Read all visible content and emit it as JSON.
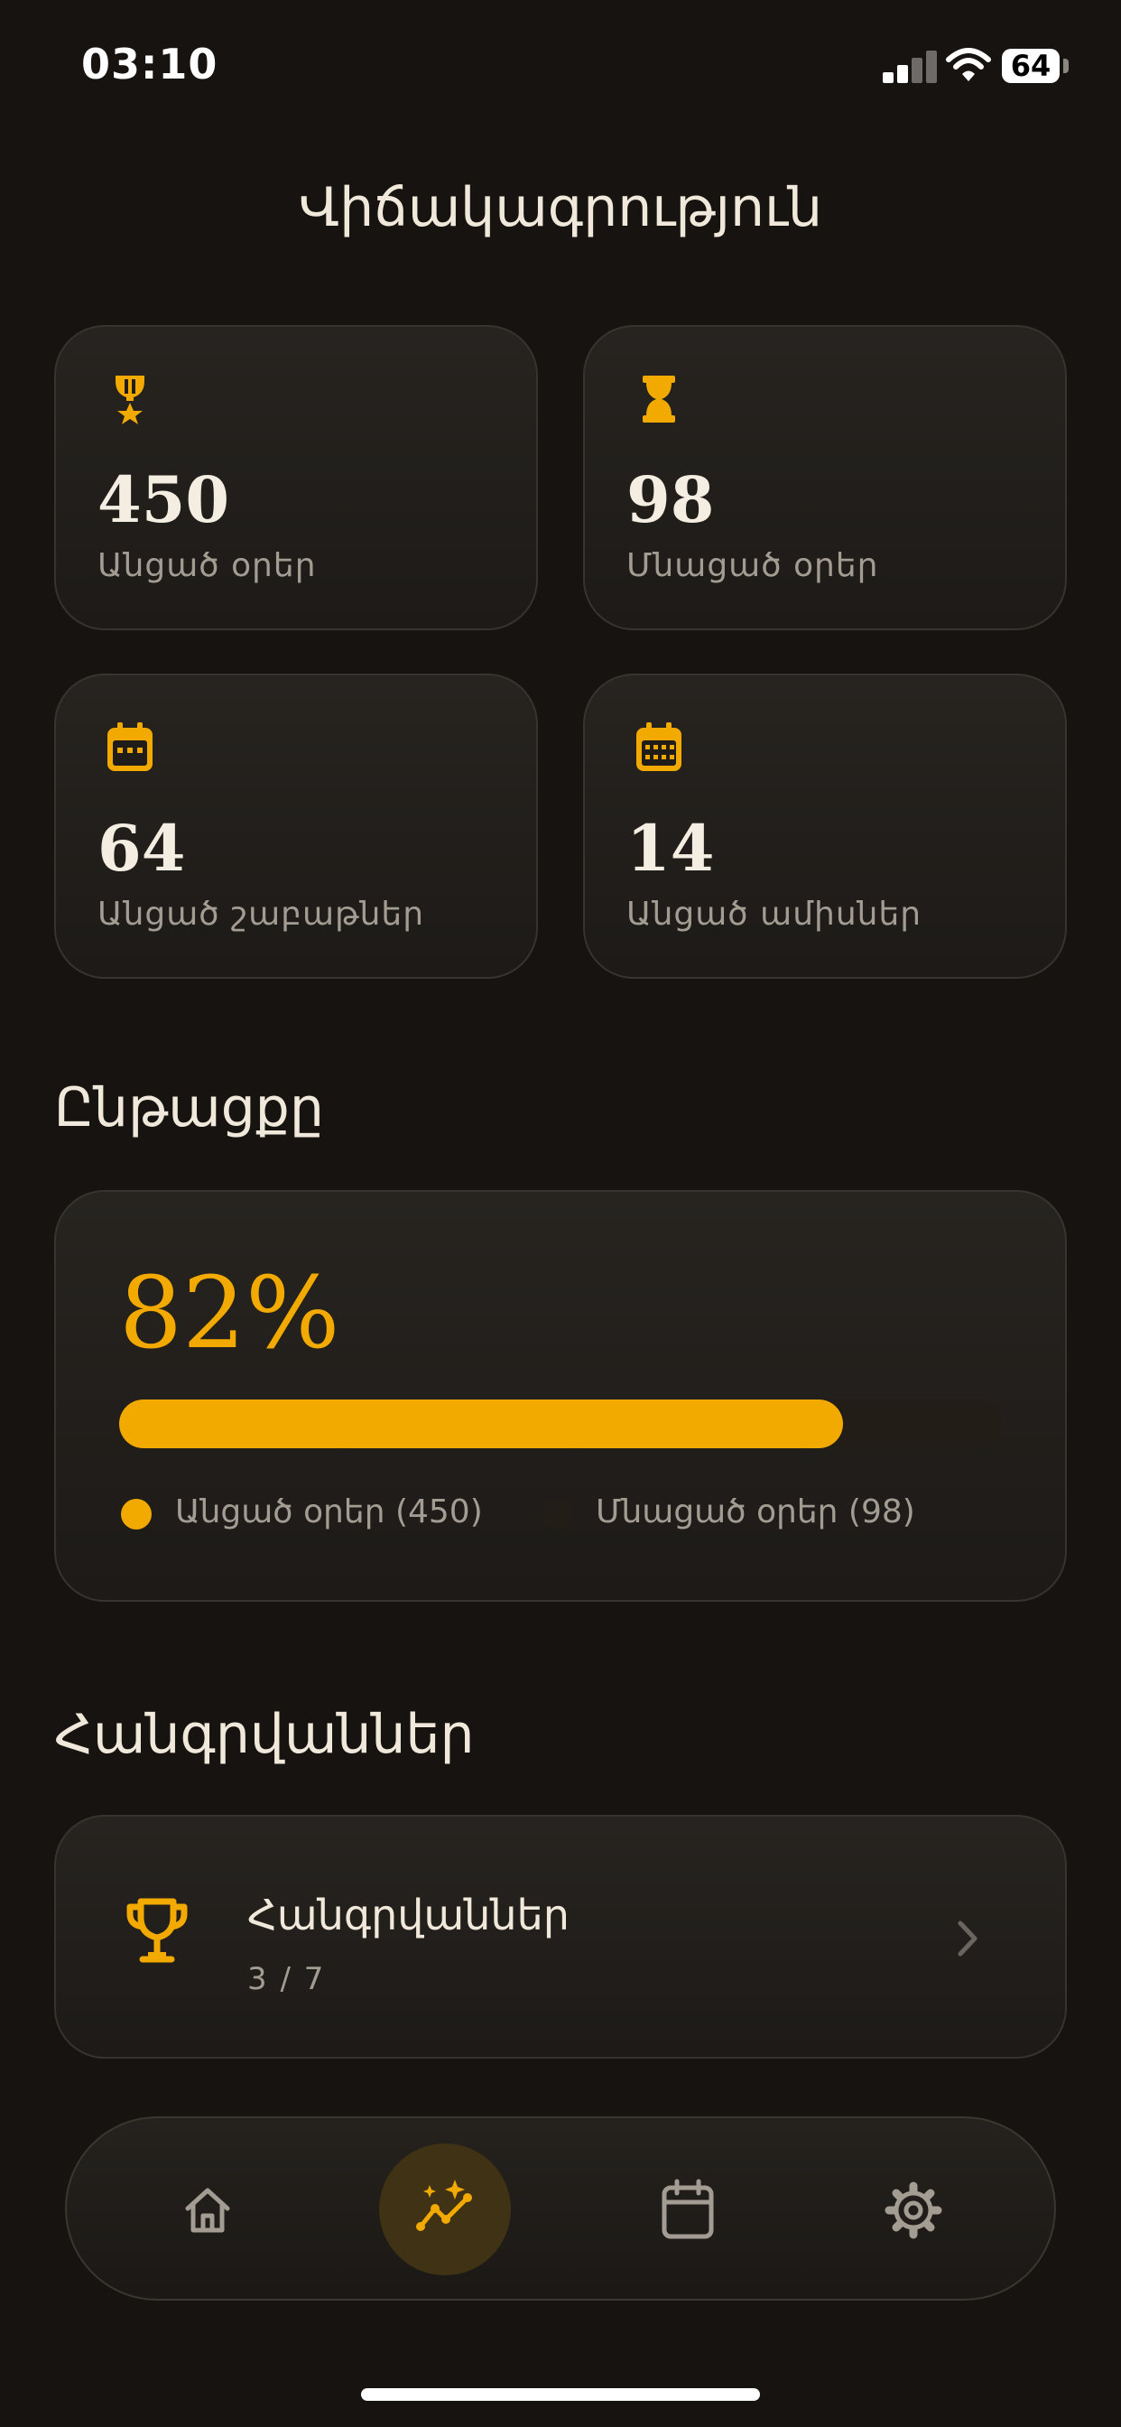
{
  "status_bar": {
    "time": "03:10",
    "battery": "64"
  },
  "page_title": "Վիճակագրություն",
  "stats": [
    {
      "icon": "medal-icon",
      "value": "450",
      "label": "Անցած օրեր"
    },
    {
      "icon": "hourglass-icon",
      "value": "98",
      "label": "Մնացած օրեր"
    },
    {
      "icon": "calendar-week-icon",
      "value": "64",
      "label": "Անցած շաբաթներ"
    },
    {
      "icon": "calendar-month-icon",
      "value": "14",
      "label": "Անցած ամիսներ"
    }
  ],
  "progress": {
    "section_title": "Ընթացքը",
    "percent_label": "82%",
    "fraction": 0.82,
    "legend": [
      {
        "label": "Անցած օրեր (450)",
        "color": "#f2a900"
      },
      {
        "label": "Մնացած օրեր (98)",
        "color": "#221d17"
      }
    ]
  },
  "achievements": {
    "section_title": "Հանգրվաններ",
    "item_title": "Հանգրվաններ",
    "item_count": "3 / 7"
  },
  "tabbar": {
    "tabs": [
      {
        "name": "home",
        "icon": "home-icon",
        "active": false
      },
      {
        "name": "stats",
        "icon": "trend-sparkle-icon",
        "active": true
      },
      {
        "name": "calendar",
        "icon": "calendar-icon",
        "active": false
      },
      {
        "name": "settings",
        "icon": "gear-icon",
        "active": false
      }
    ]
  },
  "colors": {
    "accent": "#f2a900",
    "background": "#161310",
    "card": "#231f1b",
    "muted_text": "#a29c93"
  }
}
